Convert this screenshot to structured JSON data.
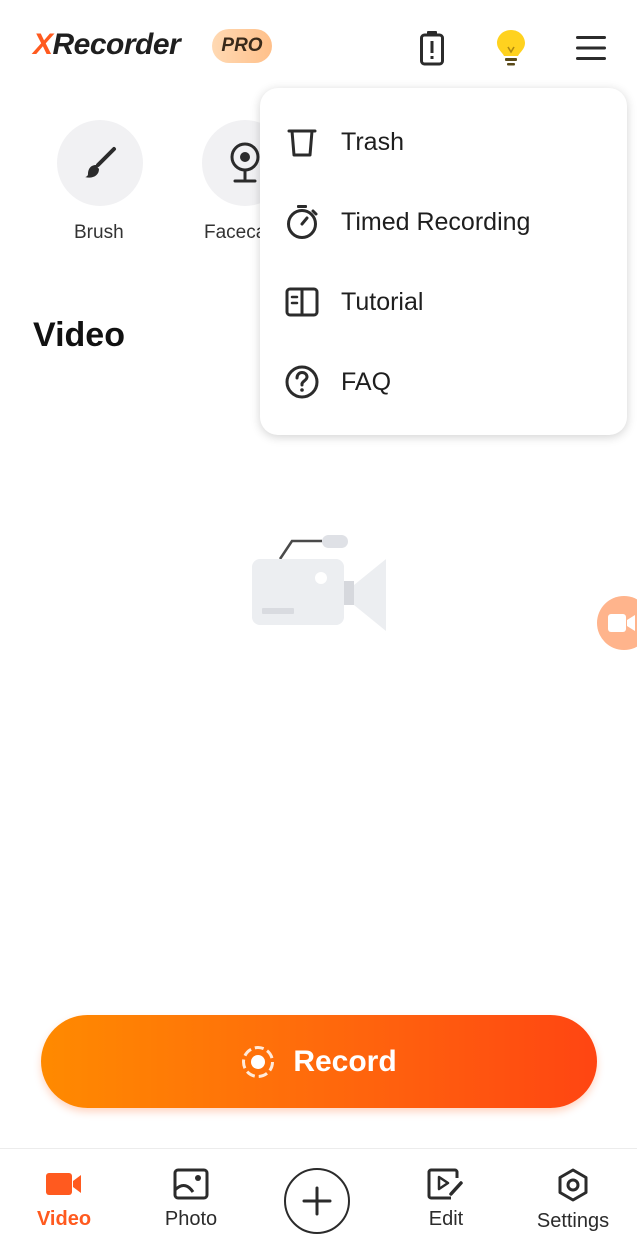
{
  "header": {
    "logo_x": "X",
    "logo_rest": "Recorder",
    "badge": "PRO"
  },
  "tools": [
    {
      "label": "Brush",
      "icon": "brush-icon"
    },
    {
      "label": "Facecam",
      "icon": "facecam-icon"
    }
  ],
  "section": {
    "title": "Video"
  },
  "menu": {
    "items": [
      {
        "label": "Trash",
        "icon": "trash-icon"
      },
      {
        "label": "Timed Recording",
        "icon": "timer-icon"
      },
      {
        "label": "Tutorial",
        "icon": "tutorial-icon"
      },
      {
        "label": "FAQ",
        "icon": "help-icon"
      }
    ]
  },
  "record": {
    "label": "Record"
  },
  "nav": {
    "items": [
      {
        "label": "Video",
        "active": true
      },
      {
        "label": "Photo"
      },
      {
        "label": "Edit"
      },
      {
        "label": "Settings"
      }
    ]
  },
  "colors": {
    "accent": "#ff5a1f",
    "record_gradient_start": "#ff8a00",
    "record_gradient_end": "#ff4512",
    "bulb": "#ffd21f"
  }
}
